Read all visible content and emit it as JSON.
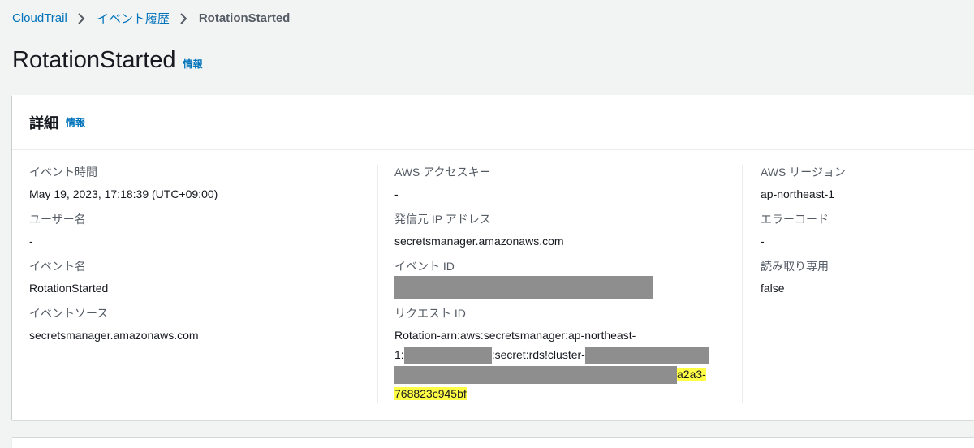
{
  "breadcrumb": {
    "items": [
      "CloudTrail",
      "イベント履歴"
    ],
    "current": "RotationStarted"
  },
  "page": {
    "title": "RotationStarted",
    "info": "情報"
  },
  "details": {
    "header": "詳細",
    "info": "情報",
    "col1": [
      {
        "label": "イベント時間",
        "value": "May 19, 2023, 17:18:39 (UTC+09:00)"
      },
      {
        "label": "ユーザー名",
        "value": "-"
      },
      {
        "label": "イベント名",
        "value": "RotationStarted"
      },
      {
        "label": "イベントソース",
        "value": "secretsmanager.amazonaws.com"
      }
    ],
    "col2": [
      {
        "label": "AWS アクセスキー",
        "value": "-"
      },
      {
        "label": "発信元 IP アドレス",
        "value": "secretsmanager.amazonaws.com"
      },
      {
        "label": "イベント ID",
        "value": ""
      },
      {
        "label": "リクエスト ID",
        "value": ""
      }
    ],
    "request_id": {
      "line1": "Rotation-arn:aws:secretsmanager:ap-northeast-",
      "line2_a": "1:",
      "line2_b": ":secret:rds!cluster-",
      "line3_tail": "a2a3-",
      "line4": "768823c945bf"
    },
    "col3": [
      {
        "label": "AWS リージョン",
        "value": "ap-northeast-1"
      },
      {
        "label": "エラーコード",
        "value": "-"
      },
      {
        "label": "読み取り専用",
        "value": "false"
      }
    ]
  }
}
